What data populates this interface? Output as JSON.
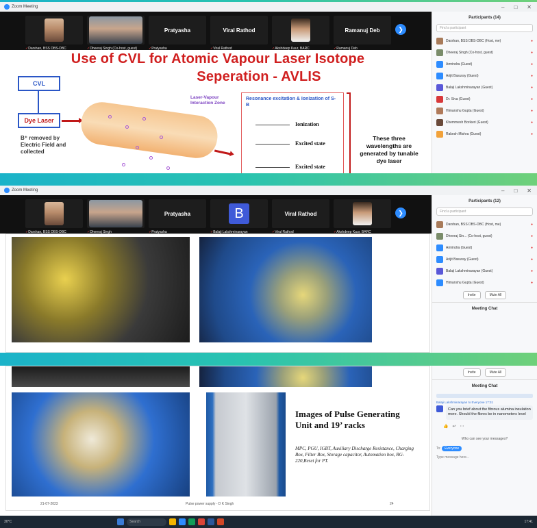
{
  "app": {
    "window_title": "Zoom Meeting"
  },
  "panel1": {
    "tiles": [
      {
        "caption": "Darshan, BSS DBS-DBC"
      },
      {
        "caption": "Dheeraj Singh (Co-host, guest)"
      },
      {
        "name": "Pratyasha",
        "caption": "Pratyasha"
      },
      {
        "name": "Viral Rathod",
        "caption": "Viral Rathod"
      },
      {
        "caption": "Akshdeep Kaur, BARC"
      },
      {
        "name": "Ramanuj Deb",
        "caption": "Ramanuj Deb"
      }
    ],
    "participants_header": "Participants (14)",
    "search_placeholder": "Find a participant",
    "participants": [
      "Darshan, BSS DBS-DBC (Host, me)",
      "Dheeraj Singh (Co-host, guest)",
      "Amrindra (Guest)",
      "Arijit Basuray (Guest)",
      "Balaji Lakshminarayan (Guest)",
      "Dr. Siva (Guest)",
      "Himanshu Gupta (Guest)",
      "Khemmesh Borikeri (Guest)",
      "Rakesh Mishra (Guest)"
    ],
    "slide": {
      "title_line1": "Use of CVL for Atomic Vapour Laser Isotope",
      "title_line2": "Seperation - AVLIS",
      "cvl_label": "CVL",
      "dye_label": "Dye Laser",
      "removed_text": "B⁺ removed by Electric Field and collected",
      "zone_label": "Laser-Vapour Interaction Zone",
      "energy_title": "Resonance excitation & Ionization of S-B",
      "levels": [
        "Ionization",
        "Excited state",
        "Excited state"
      ],
      "note": "These three wavelengths are generated by tunable dye laser"
    }
  },
  "panel2": {
    "tiles": [
      {
        "caption": "Darshan, BSS DBS-DBC"
      },
      {
        "caption": "Dheeraj Singh"
      },
      {
        "name": "Pratyasha",
        "caption": "Pratyasha"
      },
      {
        "name": "B",
        "caption": "Balaji Lakshminarayan"
      },
      {
        "name": "Viral Rathod",
        "caption": "Viral Rathod"
      },
      {
        "caption": "Akshdeep Kaur, BARC"
      }
    ],
    "participants_header": "Participants (12)",
    "search_placeholder": "Find a participant",
    "participants": [
      "Darshan, BSS DBS-DBC (Host, me)",
      "Dheeraj Sin... (Co-host, guest)",
      "Amrindra (Guest)",
      "Arijit Basuray (Guest)",
      "Balaji Lakshminarayan (Guest)",
      "Himanshu Gupta (Guest)"
    ],
    "invite_label": "Invite",
    "muteall_label": "Mute All",
    "chat_header": "Meeting Chat"
  },
  "panel3": {
    "slide": {
      "caption_title": "Images of Pulse Generating Unit and 19’ racks",
      "caption_sub": "MPC, PGU, IGBT, Auxiliary Discharge Resistance, Charging Box, Filter Box, Storage capacitor, Automation box, RG-220,Reset for PT.",
      "footer_date": "21-07-2023",
      "footer_center": "Pulse power supply - D K Singh",
      "footer_page": "24"
    },
    "invite_label": "Invite",
    "muteall_label": "Mute All",
    "chat_header": "Meeting Chat",
    "chat_meta": "Balaji Lakshminarayan to Everyone 17:31",
    "chat_message": "Can you brief about the fibrous alumina insulation more. Should the fibres be in nanometers level",
    "who_can_see": "Who can see your messages?",
    "to_label": "To:",
    "to_value": "Everyone",
    "message_placeholder": "Type message here...",
    "taskbar": {
      "search_label": "Search",
      "weather": "30°C",
      "time": "17:41"
    }
  }
}
